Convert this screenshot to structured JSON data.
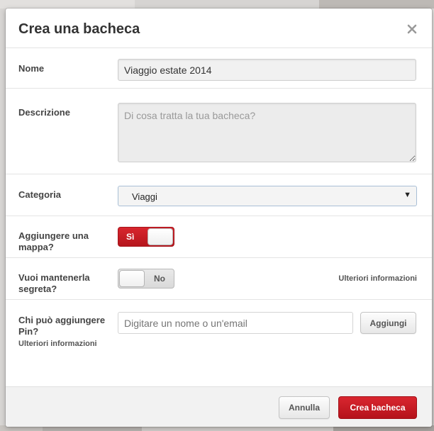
{
  "dialog": {
    "title": "Crea una bacheca",
    "close_icon": "close-icon"
  },
  "fields": {
    "name": {
      "label": "Nome",
      "value": "Viaggio estate 2014"
    },
    "description": {
      "label": "Descrizione",
      "placeholder": "Di cosa tratta la tua bacheca?"
    },
    "category": {
      "label": "Categoria",
      "value": "Viaggi"
    },
    "map": {
      "label": "Aggiungere una mappa?",
      "toggle_label": "Sì",
      "state": "on"
    },
    "secret": {
      "label": "Vuoi mantenerla segreta?",
      "toggle_label": "No",
      "state": "off",
      "more_info": "Ulteriori informazioni"
    },
    "collaborators": {
      "label": "Chi può aggiungere Pin?",
      "more_info": "Ulteriori informazioni",
      "placeholder": "Digitare un nome o un'email",
      "add_button": "Aggiungi"
    }
  },
  "footer": {
    "cancel_label": "Annulla",
    "create_label": "Crea bacheca"
  },
  "colors": {
    "accent_red": "#c8202a",
    "select_border": "#a9bfd6"
  }
}
